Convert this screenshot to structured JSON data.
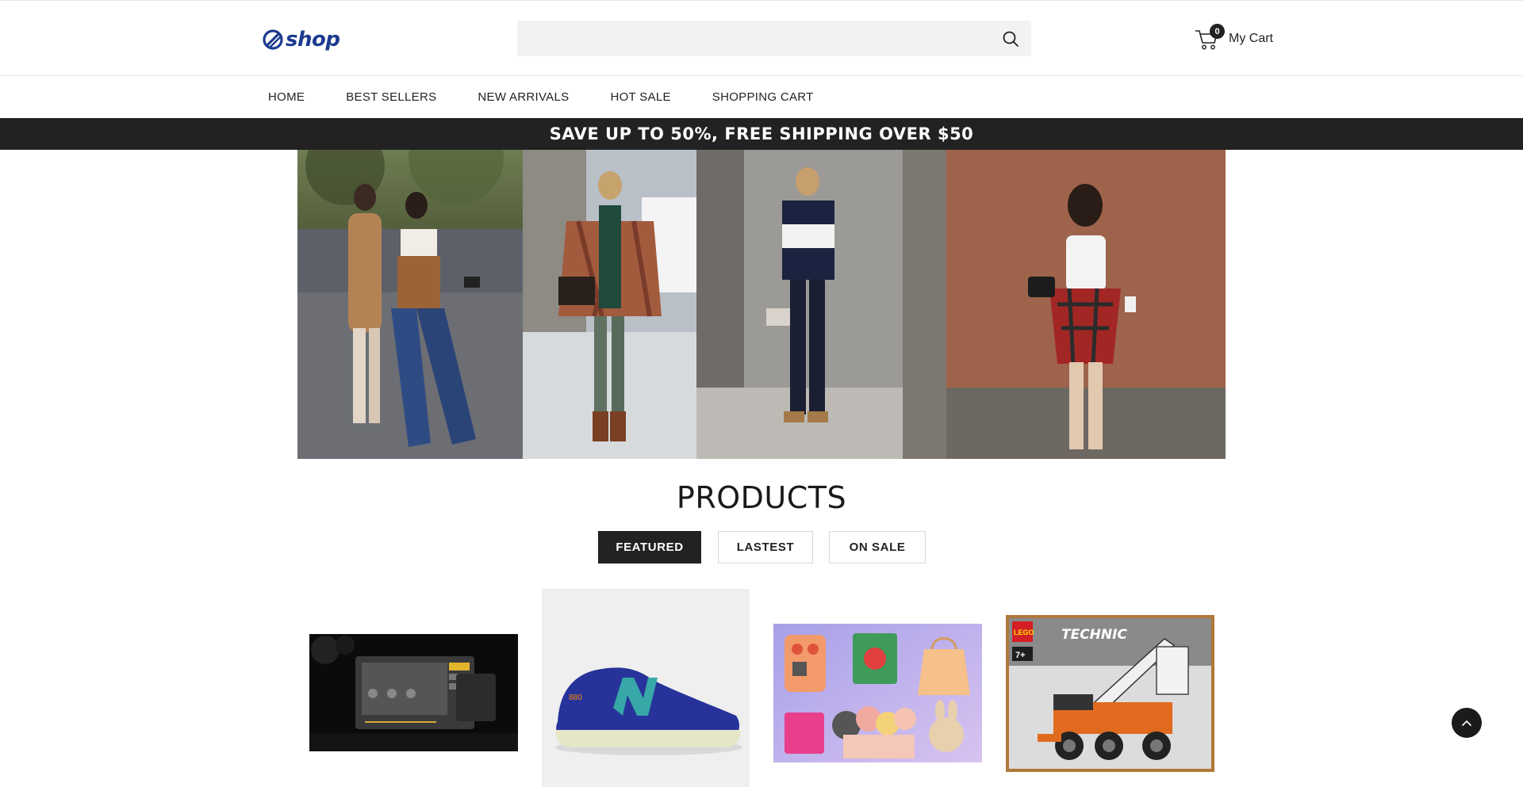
{
  "header": {
    "logo_text": "shop",
    "search": {
      "value": "",
      "placeholder": ""
    },
    "cart": {
      "count": "0",
      "label": "My Cart"
    }
  },
  "nav": {
    "items": [
      "HOME",
      "BEST SELLERS",
      "NEW ARRIVALS",
      "HOT SALE",
      "SHOPPING CART"
    ]
  },
  "promo": {
    "text": "SAVE UP TO 50%, FREE SHIPPING OVER $50"
  },
  "products": {
    "title": "PRODUCTS",
    "tabs": [
      "FEATURED",
      "LASTEST",
      "ON SALE"
    ],
    "active_tab": "FEATURED"
  },
  "product_cards": {
    "lego_brand": "LEGO",
    "lego_series": "TECHNIC",
    "lego_age": "7+",
    "shoe_size_label": "880"
  },
  "colors": {
    "accent_dark": "#222222",
    "brand_blue": "#1c3a8f"
  },
  "icons": {
    "logo": "logo-icon",
    "search": "search-icon",
    "cart": "cart-icon",
    "back_to_top": "chevron-up-icon"
  }
}
